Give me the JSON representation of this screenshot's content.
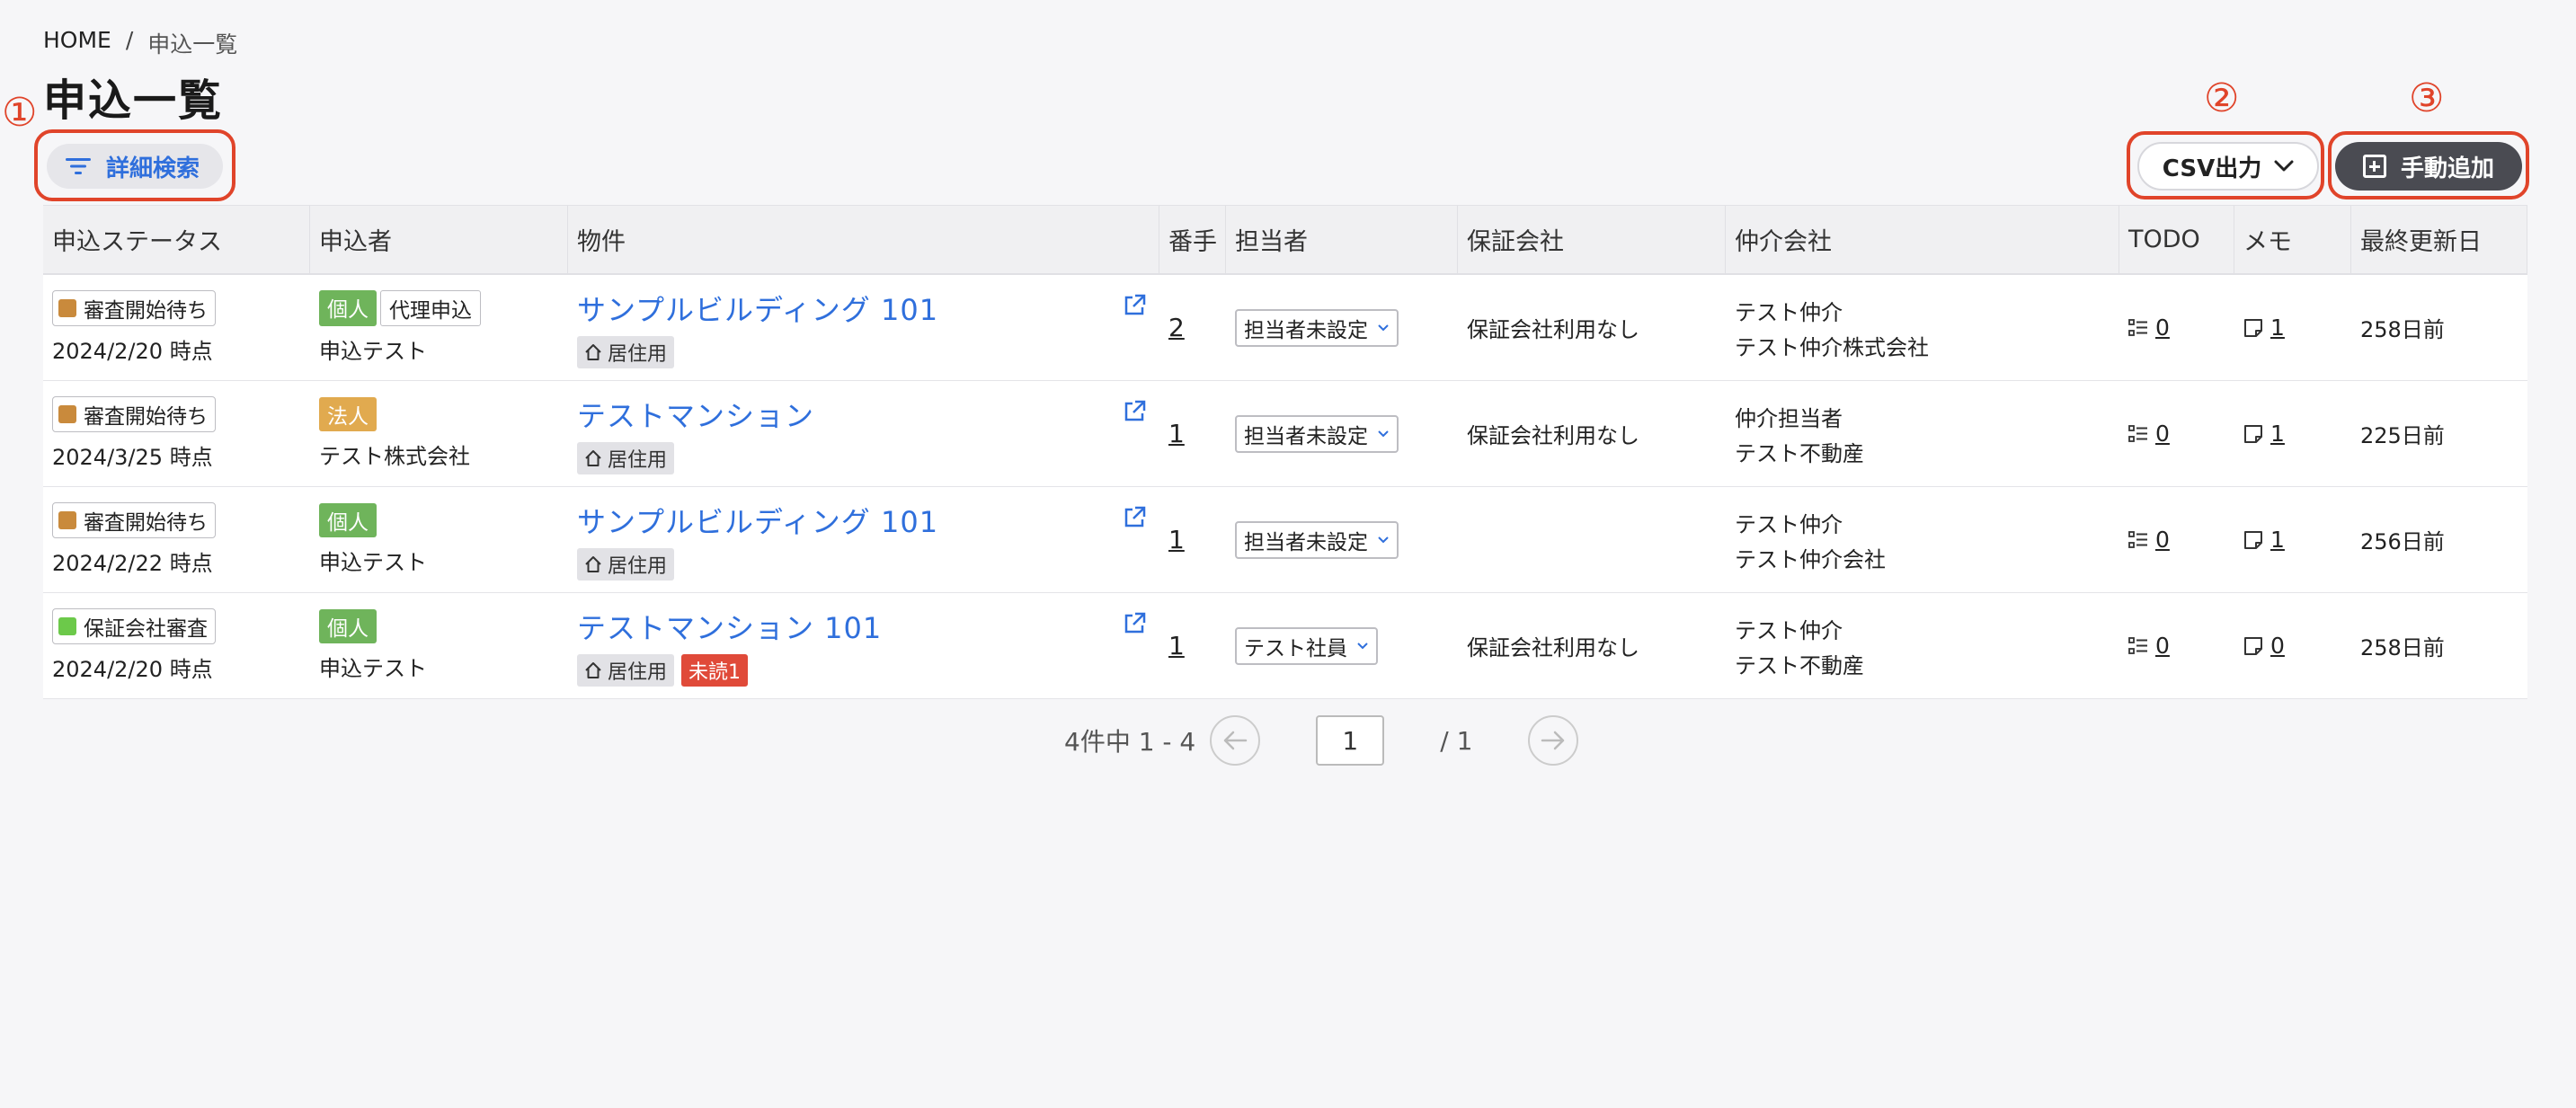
{
  "breadcrumb": {
    "home": "HOME",
    "sep": "/",
    "current": "申込一覧"
  },
  "page_title": "申込一覧",
  "annotations": {
    "a1": "①",
    "a2": "②",
    "a3": "③"
  },
  "toolbar": {
    "filter_label": "詳細検索",
    "csv_label": "CSV出力",
    "add_label": "手動追加"
  },
  "columns": [
    "申込ステータス",
    "申込者",
    "物件",
    "番手",
    "担当者",
    "保証会社",
    "仲介会社",
    "TODO",
    "メモ",
    "最終更新日"
  ],
  "rows": [
    {
      "status": "審査開始待ち",
      "status_color": "#c98a3c",
      "date": "2024/2/20 時点",
      "type": "個人",
      "proxy": "代理申込",
      "applicant": "申込テスト",
      "property": "サンプルビルディング 101",
      "use": "居住用",
      "unread": "",
      "order": "2",
      "staff": "担当者未設定",
      "guarantor": "保証会社利用なし",
      "agent1": "テスト仲介",
      "agent2": "テスト仲介株式会社",
      "todo": "0",
      "memo": "1",
      "updated": "258日前"
    },
    {
      "status": "審査開始待ち",
      "status_color": "#c98a3c",
      "date": "2024/3/25 時点",
      "type": "法人",
      "proxy": "",
      "applicant": "テスト株式会社",
      "property": "テストマンション",
      "use": "居住用",
      "unread": "",
      "order": "1",
      "staff": "担当者未設定",
      "guarantor": "保証会社利用なし",
      "agent1": "仲介担当者",
      "agent2": "テスト不動産",
      "todo": "0",
      "memo": "1",
      "updated": "225日前"
    },
    {
      "status": "審査開始待ち",
      "status_color": "#c98a3c",
      "date": "2024/2/22 時点",
      "type": "個人",
      "proxy": "",
      "applicant": "申込テスト",
      "property": "サンプルビルディング 101",
      "use": "居住用",
      "unread": "",
      "order": "1",
      "staff": "担当者未設定",
      "guarantor": "",
      "agent1": "テスト仲介",
      "agent2": "テスト仲介会社",
      "todo": "0",
      "memo": "1",
      "updated": "256日前"
    },
    {
      "status": "保証会社審査",
      "status_color": "#6cc94a",
      "date": "2024/2/20 時点",
      "type": "個人",
      "proxy": "",
      "applicant": "申込テスト",
      "property": "テストマンション 101",
      "use": "居住用",
      "unread": "未読1",
      "order": "1",
      "staff": "テスト社員",
      "guarantor": "保証会社利用なし",
      "agent1": "テスト仲介",
      "agent2": "テスト不動産",
      "todo": "0",
      "memo": "0",
      "updated": "258日前"
    }
  ],
  "pagination": {
    "summary": "4件中 1 - 4",
    "page": "1",
    "total": "/ 1"
  },
  "colors": {
    "accent": "#2f6fdc",
    "annotation": "#e0442a",
    "dark_button": "#4a4b52"
  }
}
